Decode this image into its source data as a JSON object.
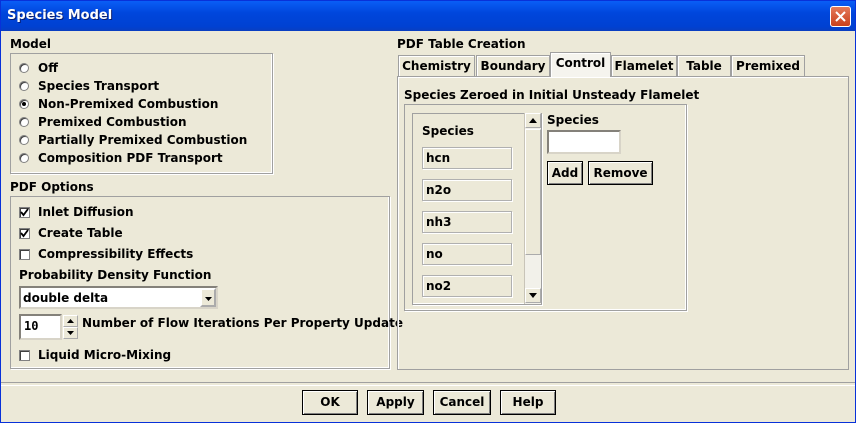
{
  "window": {
    "title": "Species Model"
  },
  "model": {
    "label": "Model",
    "options": [
      {
        "label": "Off",
        "selected": false
      },
      {
        "label": "Species Transport",
        "selected": false
      },
      {
        "label": "Non-Premixed Combustion",
        "selected": true
      },
      {
        "label": "Premixed Combustion",
        "selected": false
      },
      {
        "label": "Partially Premixed Combustion",
        "selected": false
      },
      {
        "label": "Composition PDF Transport",
        "selected": false
      }
    ]
  },
  "pdf_options": {
    "label": "PDF Options",
    "inlet_diffusion": {
      "label": "Inlet Diffusion",
      "checked": true
    },
    "create_table": {
      "label": "Create Table",
      "checked": true
    },
    "compressibility": {
      "label": "Compressibility Effects",
      "checked": false
    },
    "pdf_label": "Probability Density Function",
    "pdf_value": "double delta",
    "iterations_value": "10",
    "iterations_label": "Number of Flow Iterations Per Property Update",
    "liquid_micro": {
      "label": "Liquid Micro-Mixing",
      "checked": false
    }
  },
  "pdf_table": {
    "label": "PDF Table Creation",
    "tabs": [
      {
        "label": "Chemistry",
        "active": false
      },
      {
        "label": "Boundary",
        "active": false
      },
      {
        "label": "Control",
        "active": true
      },
      {
        "label": "Flamelet",
        "active": false
      },
      {
        "label": "Table",
        "active": false
      },
      {
        "label": "Premixed",
        "active": false
      }
    ],
    "panel_title": "Species Zeroed in Initial Unsteady Flamelet",
    "list_header": "Species",
    "species": [
      "hcn",
      "n2o",
      "nh3",
      "no",
      "no2"
    ],
    "input_label": "Species",
    "input_value": "",
    "add_label": "Add",
    "remove_label": "Remove"
  },
  "footer": {
    "ok": "OK",
    "apply": "Apply",
    "cancel": "Cancel",
    "help": "Help"
  }
}
